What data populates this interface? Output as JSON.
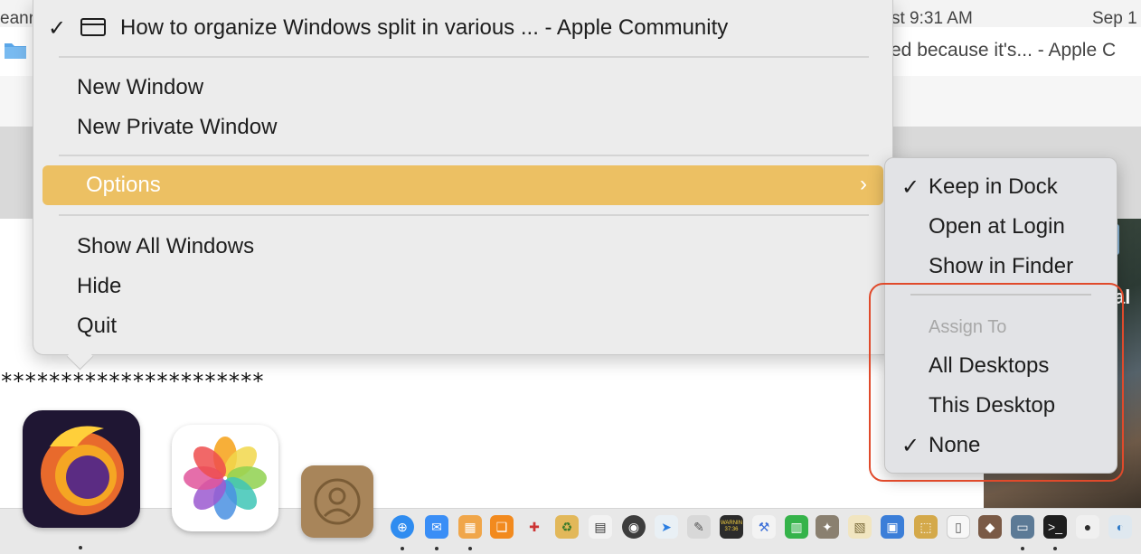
{
  "background": {
    "topbar_texts": [
      "eanr",
      "st 9:31 AM",
      "Sep 1"
    ],
    "row_text_left": "ed because it's... - Apple C",
    "stars_text": "**********************",
    "right_partial_text": "al"
  },
  "context_menu": {
    "window_title": "How to organize Windows split in various ... - Apple Community",
    "window_checked": true,
    "items_group1": [
      "New Window",
      "New Private Window"
    ],
    "highlighted_item": "Options",
    "items_group2": [
      "Show All Windows",
      "Hide",
      "Quit"
    ],
    "highlight_color": "#ecc063"
  },
  "submenu": {
    "items": [
      {
        "label": "Keep in Dock",
        "checked": true
      },
      {
        "label": "Open at Login",
        "checked": false
      },
      {
        "label": "Show in Finder",
        "checked": false
      }
    ],
    "section_header": "Assign To",
    "assign_items": [
      {
        "label": "All Desktops",
        "checked": false
      },
      {
        "label": "This Desktop",
        "checked": false
      },
      {
        "label": "None",
        "checked": true
      }
    ],
    "check_glyph": "✓",
    "annotation_color": "#e04a2b"
  },
  "dock": {
    "apps": [
      "firefox-icon",
      "photos-icon",
      "contacts-icon",
      "safari-icon",
      "mail-icon",
      "preview-icon",
      "books-icon",
      "color-picker-icon",
      "recycle-icon",
      "calculator-icon",
      "quicktime-icon",
      "maps-icon",
      "script-icon",
      "console-icon",
      "xcode-icon",
      "numbers-icon",
      "gimp-icon",
      "document-icon",
      "photo-viewer-icon",
      "archive-icon",
      "textedit-icon",
      "app-icon",
      "finder-icon",
      "terminal-icon",
      "elephant-icon",
      "disk-icon"
    ],
    "console_label": "WARNIN 37:36"
  }
}
